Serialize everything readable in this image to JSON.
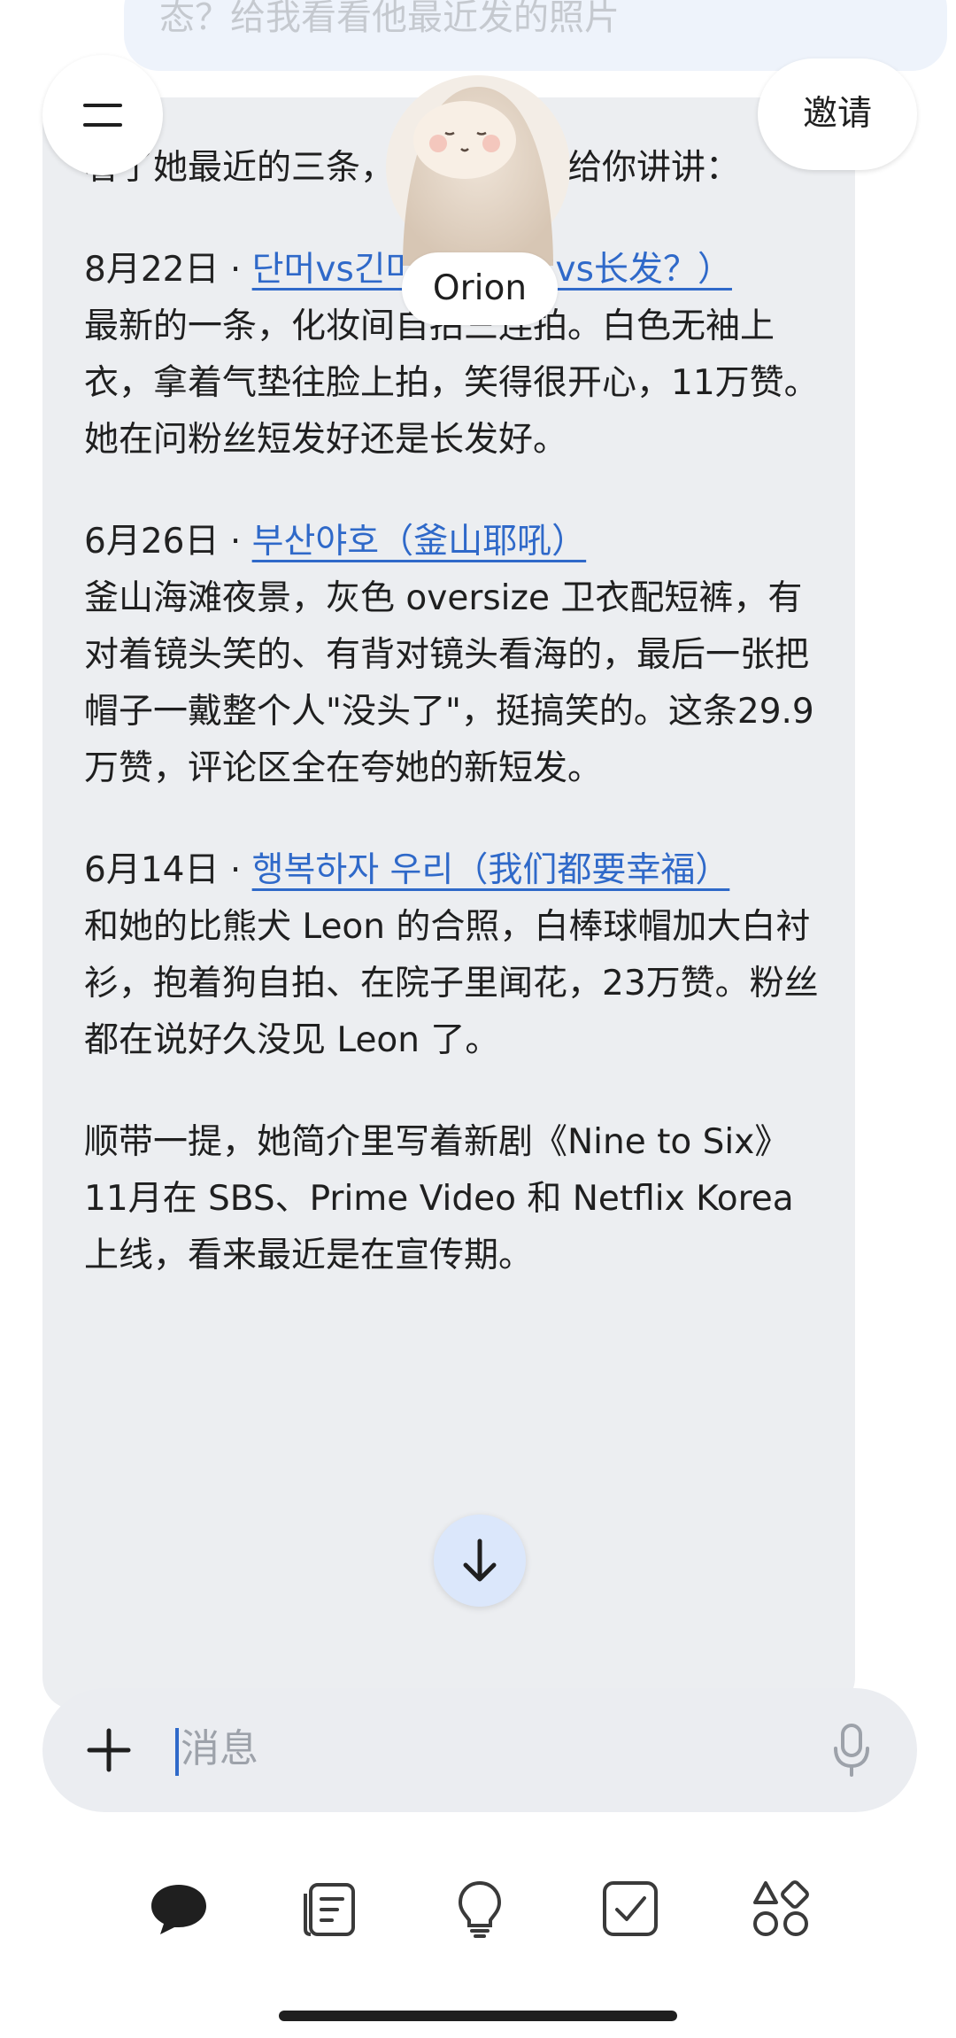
{
  "header": {
    "prev_message": "态？给我看看他最近发的照片",
    "invite_label": "邀请",
    "agent_name": "Orion"
  },
  "message": {
    "intro": "看了她最近的三条，都是多图，给你讲讲：",
    "entries": [
      {
        "date": "8月22日 · ",
        "link": "단머vs긴머？（短发vs长发？）",
        "body": "最新的一条，化妆间自拍三连拍。白色无袖上衣，拿着气垫往脸上拍，笑得很开心，11万赞。她在问粉丝短发好还是长发好。"
      },
      {
        "date": "6月26日 · ",
        "link": "부산야호（釜山耶吼）",
        "body": "釜山海滩夜景，灰色 oversize 卫衣配短裤，有对着镜头笑的、有背对镜头看海的，最后一张把帽子一戴整个人\"没头了\"，挺搞笑的。这条29.9万赞，评论区全在夸她的新短发。"
      },
      {
        "date": "6月14日 · ",
        "link": "행복하자 우리（我们都要幸福）",
        "body": "和她的比熊犬 Leon 的合照，白棒球帽加大白衬衫，抱着狗自拍、在院子里闻花，23万赞。粉丝都在说好久没见 Leon 了。"
      }
    ],
    "footer": "顺带一提，她简介里写着新剧《Nine to Six》11月在 SBS、Prime Video 和 Netflix Korea 上线，看来最近是在宣传期。"
  },
  "composer": {
    "placeholder": "消息"
  },
  "bottom_nav": [
    "chat-icon",
    "notes-icon",
    "lightbulb-icon",
    "checkbox-icon",
    "apps-icon"
  ],
  "colors": {
    "link": "#2f69c9",
    "card_bg": "#eceef1",
    "composer_bg": "#ebedf1",
    "scroll_button_bg": "#dbe7fb"
  }
}
